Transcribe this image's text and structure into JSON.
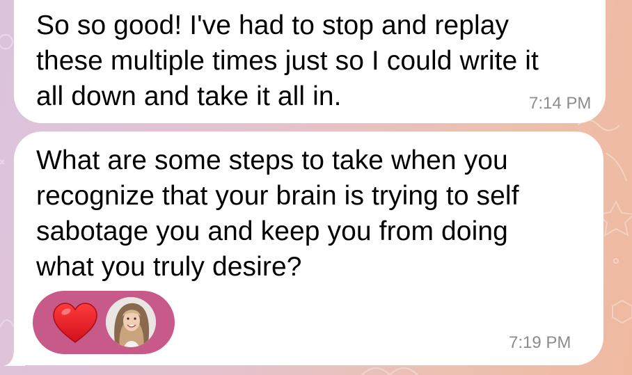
{
  "chat": {
    "messages": [
      {
        "text": "So so good! I've had to stop and replay\nthese multiple times just so I could write it\nall down and take it all in.",
        "time": "7:14 PM"
      },
      {
        "text": "What are some steps to take when you\nrecognize that your brain is trying to self\nsabotage you and keep you from doing\nwhat you truly desire?",
        "time": "7:19 PM",
        "reaction": {
          "icon": "heart-icon",
          "avatar": "user-avatar"
        }
      }
    ]
  },
  "colors": {
    "bubble": "#ffffff",
    "timestamp": "#8c8c8c",
    "reaction_pill": "#c85a8a",
    "heart": "#e8202a",
    "wallpaper_left": "#dcc3dd",
    "wallpaper_right": "#efb9a0"
  }
}
